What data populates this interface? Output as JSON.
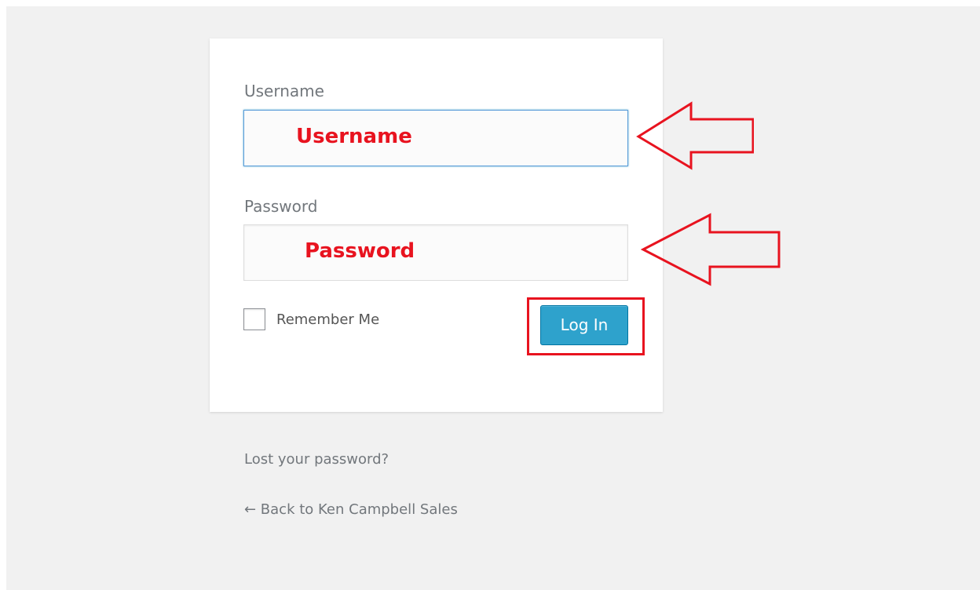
{
  "form": {
    "username_label": "Username",
    "username_annotation": "Username",
    "password_label": "Password",
    "password_annotation": "Password",
    "remember_label": "Remember Me",
    "remember_checked": false,
    "login_button_label": "Log In"
  },
  "links": {
    "lost_password": "Lost your password?",
    "back_to_site": "← Back to Ken Campbell Sales"
  },
  "colors": {
    "background": "#f1f1f1",
    "card": "#ffffff",
    "button": "#2ea2cc",
    "annotation_red": "#e8131f",
    "focus_border": "#5b9dd9",
    "label_text": "#72777c"
  },
  "icons": {
    "username_arrow": "left-arrow-outline-icon",
    "password_arrow": "left-arrow-outline-icon",
    "checkbox": "checkbox-unchecked-icon"
  }
}
